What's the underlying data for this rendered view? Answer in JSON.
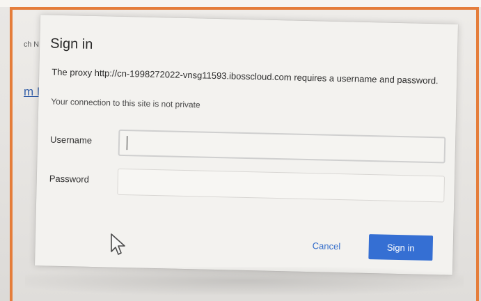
{
  "background": {
    "top_partial_text": "ch N",
    "left_partial_link": "m I"
  },
  "dialog": {
    "title": "Sign in",
    "proxy_message": "The proxy http://cn-1998272022-vnsg11593.ibosscloud.com requires a username and password.",
    "privacy_message": "Your connection to this site is not private",
    "username_label": "Username",
    "password_label": "Password",
    "username_value": "",
    "password_value": "",
    "cancel_label": "Cancel",
    "signin_label": "Sign in"
  },
  "colors": {
    "frame_accent": "#e57d3a",
    "primary_button": "#356fd3",
    "cancel_link": "#366fcb"
  },
  "icons": {
    "cursor": "arrow-cursor-icon"
  }
}
